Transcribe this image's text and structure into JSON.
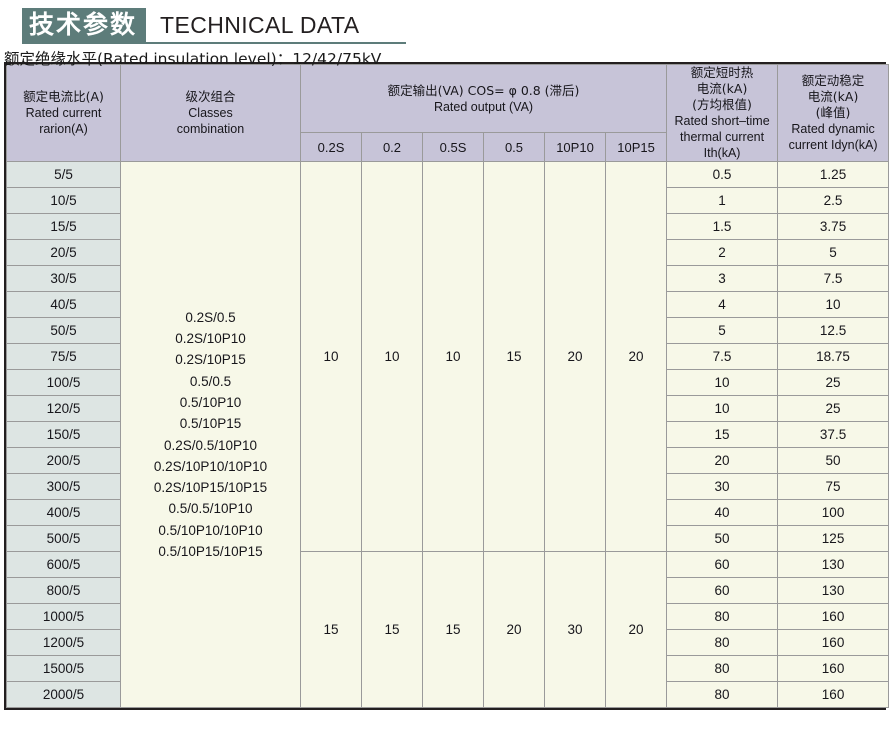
{
  "title": {
    "cn": "技术参数",
    "en": "TECHNICAL DATA",
    "accent_color": "#5d7c7a"
  },
  "subtitle": "额定绝缘水平(Rated insulation level)：12/42/75kV",
  "table": {
    "headers": {
      "rated_current_ratio": {
        "cn": "额定电流比(A)",
        "en_line1": "Rated current",
        "en_line2": "rarion(A)"
      },
      "classes_combination": {
        "cn": "级次组合",
        "en_line1": "Classes",
        "en_line2": "combination"
      },
      "rated_output": {
        "cn": "额定输出(VA) COS= φ 0.8 (滞后)",
        "en": "Rated output (VA)"
      },
      "rated_output_sub": [
        "0.2S",
        "0.2",
        "0.5S",
        "0.5",
        "10P10",
        "10P15"
      ],
      "thermal_current": {
        "cn_line1": "额定短时热",
        "cn_line2": "电流(kA)",
        "cn_line3": "(方均根值)",
        "en_line1": "Rated short–time",
        "en_line2": "thermal current",
        "en_line3": "Ith(kA)"
      },
      "dynamic_current": {
        "cn_line1": "额定动稳定",
        "cn_line2": "电流(kA)",
        "cn_line3": "(峰值)",
        "en_line1": "Rated dynamic",
        "en_line2": "current Idyn(kA)"
      }
    },
    "classes_combination_text": "0.2S/0.5\n0.2S/10P10\n0.2S/10P15\n0.5/0.5\n0.5/10P10\n0.5/10P15\n0.2S/0.5/10P10\n0.2S/10P10/10P10\n0.2S/10P15/10P15\n0.5/0.5/10P10\n0.5/10P10/10P10\n0.5/10P15/10P15",
    "rated_output_group1": [
      "10",
      "10",
      "10",
      "15",
      "20",
      "20"
    ],
    "rated_output_group2": [
      "15",
      "15",
      "15",
      "20",
      "30",
      "20"
    ],
    "rows": [
      {
        "ratio": "5/5",
        "th": "0.5",
        "dyn": "1.25"
      },
      {
        "ratio": "10/5",
        "th": "1",
        "dyn": "2.5"
      },
      {
        "ratio": "15/5",
        "th": "1.5",
        "dyn": "3.75"
      },
      {
        "ratio": "20/5",
        "th": "2",
        "dyn": "5"
      },
      {
        "ratio": "30/5",
        "th": "3",
        "dyn": "7.5"
      },
      {
        "ratio": "40/5",
        "th": "4",
        "dyn": "10"
      },
      {
        "ratio": "50/5",
        "th": "5",
        "dyn": "12.5"
      },
      {
        "ratio": "75/5",
        "th": "7.5",
        "dyn": "18.75"
      },
      {
        "ratio": "100/5",
        "th": "10",
        "dyn": "25"
      },
      {
        "ratio": "120/5",
        "th": "10",
        "dyn": "25"
      },
      {
        "ratio": "150/5",
        "th": "15",
        "dyn": "37.5"
      },
      {
        "ratio": "200/5",
        "th": "20",
        "dyn": "50"
      },
      {
        "ratio": "300/5",
        "th": "30",
        "dyn": "75"
      },
      {
        "ratio": "400/5",
        "th": "40",
        "dyn": "100"
      },
      {
        "ratio": "500/5",
        "th": "50",
        "dyn": "125"
      },
      {
        "ratio": "600/5",
        "th": "60",
        "dyn": "130"
      },
      {
        "ratio": "800/5",
        "th": "60",
        "dyn": "130"
      },
      {
        "ratio": "1000/5",
        "th": "80",
        "dyn": "160"
      },
      {
        "ratio": "1200/5",
        "th": "80",
        "dyn": "160"
      },
      {
        "ratio": "1500/5",
        "th": "80",
        "dyn": "160"
      },
      {
        "ratio": "2000/5",
        "th": "80",
        "dyn": "160"
      }
    ],
    "group1_row_count": 15
  }
}
